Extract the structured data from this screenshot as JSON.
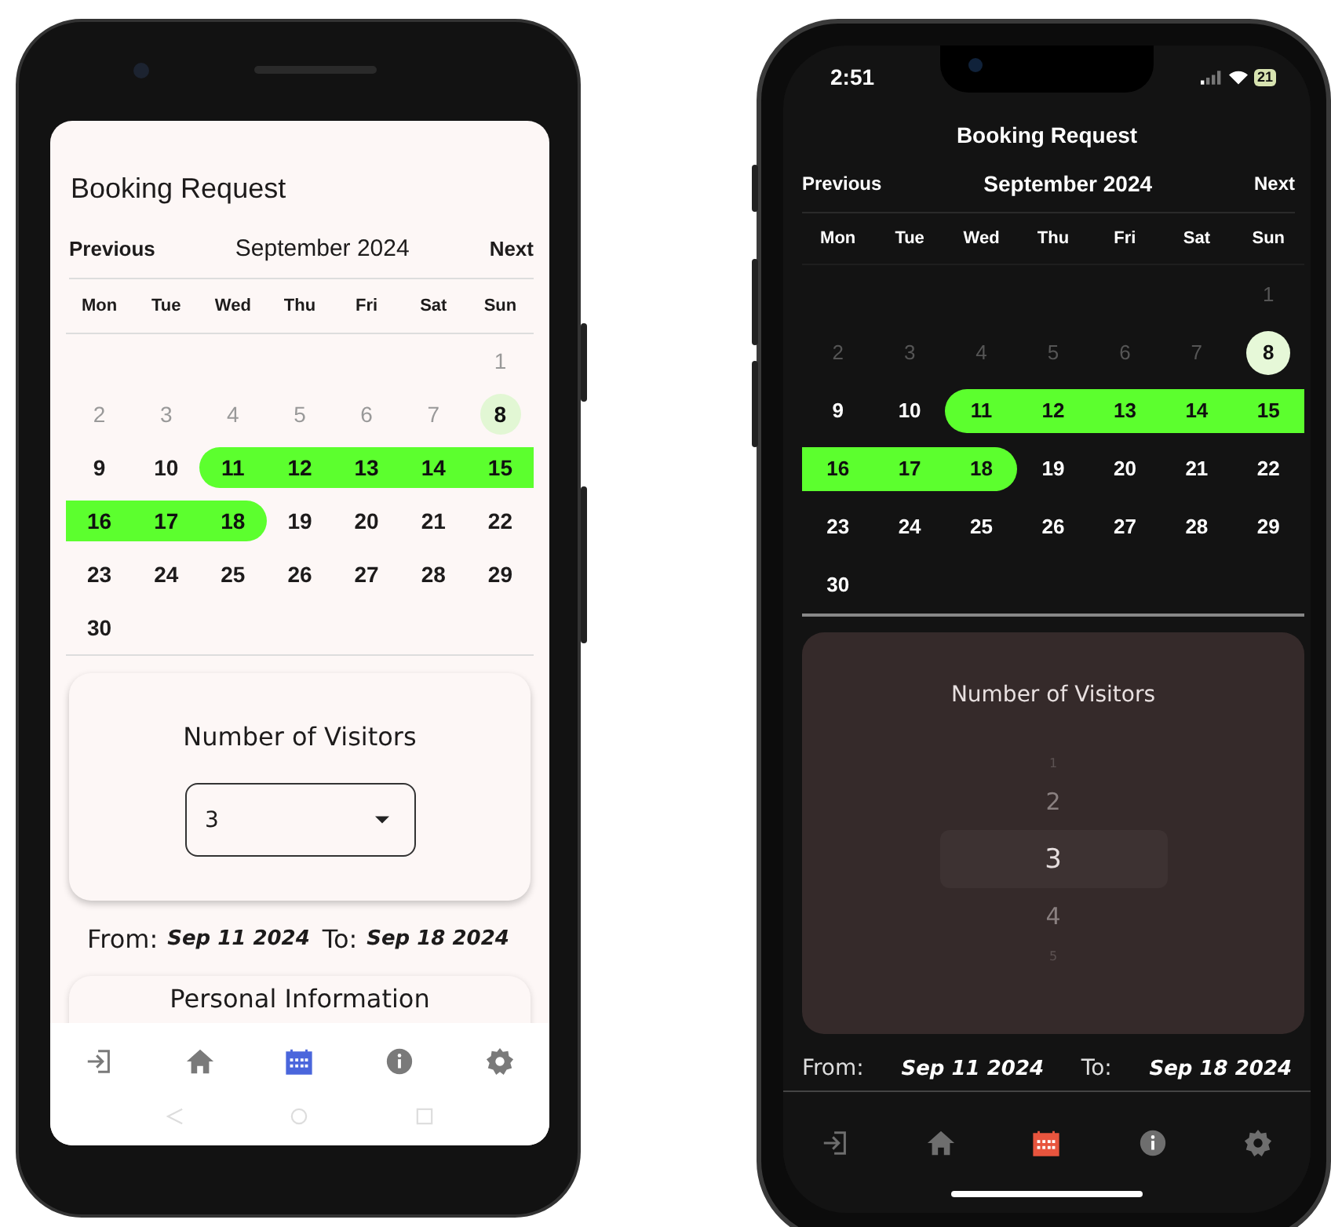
{
  "phones": [
    {
      "kind": "android",
      "title": "Booking Request",
      "calendar": {
        "previous": "Previous",
        "month": "September 2024",
        "next": "Next",
        "weekdays": [
          "Mon",
          "Tue",
          "Wed",
          "Thu",
          "Fri",
          "Sat",
          "Sun"
        ],
        "weeks": [
          [
            {
              "day": "1",
              "kind": "past",
              "selected": false
            }
          ],
          [
            {
              "day": "2",
              "kind": "past",
              "selected": false
            },
            {
              "day": "3",
              "kind": "past",
              "selected": false
            },
            {
              "day": "4",
              "kind": "past",
              "selected": false
            },
            {
              "day": "5",
              "kind": "past",
              "selected": false
            },
            {
              "day": "6",
              "kind": "past",
              "selected": false
            },
            {
              "day": "7",
              "kind": "past",
              "selected": false
            },
            {
              "day": "8",
              "kind": "today",
              "selected": false
            }
          ],
          [
            {
              "day": "9",
              "kind": "normal",
              "selected": false
            },
            {
              "day": "10",
              "kind": "normal",
              "selected": false
            },
            {
              "day": "11",
              "kind": "normal",
              "selected": true
            },
            {
              "day": "12",
              "kind": "normal",
              "selected": true
            },
            {
              "day": "13",
              "kind": "normal",
              "selected": true
            },
            {
              "day": "14",
              "kind": "normal",
              "selected": true
            },
            {
              "day": "15",
              "kind": "normal",
              "selected": true
            }
          ],
          [
            {
              "day": "16",
              "kind": "normal",
              "selected": true
            },
            {
              "day": "17",
              "kind": "normal",
              "selected": true
            },
            {
              "day": "18",
              "kind": "normal",
              "selected": true
            },
            {
              "day": "19",
              "kind": "normal",
              "selected": false
            },
            {
              "day": "20",
              "kind": "normal",
              "selected": false
            },
            {
              "day": "21",
              "kind": "normal",
              "selected": false
            },
            {
              "day": "22",
              "kind": "normal",
              "selected": false
            }
          ],
          [
            {
              "day": "23",
              "kind": "normal",
              "selected": false
            },
            {
              "day": "24",
              "kind": "normal",
              "selected": false
            },
            {
              "day": "25",
              "kind": "normal",
              "selected": false
            },
            {
              "day": "26",
              "kind": "normal",
              "selected": false
            },
            {
              "day": "27",
              "kind": "normal",
              "selected": false
            },
            {
              "day": "28",
              "kind": "normal",
              "selected": false
            },
            {
              "day": "29",
              "kind": "normal",
              "selected": false
            }
          ],
          [
            {
              "day": "30",
              "kind": "normal",
              "selected": false
            }
          ]
        ]
      },
      "visitors": {
        "label": "Number of Visitors",
        "kind": "dropdown",
        "value": "3"
      },
      "dates": {
        "from_label": "From:",
        "from": "Sep 11 2024",
        "to_label": "To:",
        "to": "Sep 18 2024"
      },
      "next_card": {
        "title": "Personal Information"
      },
      "nav": [
        {
          "kind": "login",
          "selected": false
        },
        {
          "kind": "home",
          "selected": false
        },
        {
          "kind": "calendar",
          "selected": true
        },
        {
          "kind": "info",
          "selected": false
        },
        {
          "kind": "settings",
          "selected": false
        }
      ]
    },
    {
      "kind": "ios",
      "status_bar": {
        "time": "2:51",
        "battery": "21"
      },
      "title": "Booking Request",
      "calendar": {
        "previous": "Previous",
        "month": "September 2024",
        "next": "Next",
        "weekdays": [
          "Mon",
          "Tue",
          "Wed",
          "Thu",
          "Fri",
          "Sat",
          "Sun"
        ],
        "weeks": [
          [
            {
              "day": "1",
              "kind": "past",
              "selected": false
            }
          ],
          [
            {
              "day": "2",
              "kind": "past",
              "selected": false
            },
            {
              "day": "3",
              "kind": "past",
              "selected": false
            },
            {
              "day": "4",
              "kind": "past",
              "selected": false
            },
            {
              "day": "5",
              "kind": "past",
              "selected": false
            },
            {
              "day": "6",
              "kind": "past",
              "selected": false
            },
            {
              "day": "7",
              "kind": "past",
              "selected": false
            },
            {
              "day": "8",
              "kind": "today",
              "selected": false
            }
          ],
          [
            {
              "day": "9",
              "kind": "normal",
              "selected": false
            },
            {
              "day": "10",
              "kind": "normal",
              "selected": false
            },
            {
              "day": "11",
              "kind": "normal",
              "selected": true
            },
            {
              "day": "12",
              "kind": "normal",
              "selected": true
            },
            {
              "day": "13",
              "kind": "normal",
              "selected": true
            },
            {
              "day": "14",
              "kind": "normal",
              "selected": true
            },
            {
              "day": "15",
              "kind": "normal",
              "selected": true
            }
          ],
          [
            {
              "day": "16",
              "kind": "normal",
              "selected": true
            },
            {
              "day": "17",
              "kind": "normal",
              "selected": true
            },
            {
              "day": "18",
              "kind": "normal",
              "selected": true
            },
            {
              "day": "19",
              "kind": "normal",
              "selected": false
            },
            {
              "day": "20",
              "kind": "normal",
              "selected": false
            },
            {
              "day": "21",
              "kind": "normal",
              "selected": false
            },
            {
              "day": "22",
              "kind": "normal",
              "selected": false
            }
          ],
          [
            {
              "day": "23",
              "kind": "normal",
              "selected": false
            },
            {
              "day": "24",
              "kind": "normal",
              "selected": false
            },
            {
              "day": "25",
              "kind": "normal",
              "selected": false
            },
            {
              "day": "26",
              "kind": "normal",
              "selected": false
            },
            {
              "day": "27",
              "kind": "normal",
              "selected": false
            },
            {
              "day": "28",
              "kind": "normal",
              "selected": false
            },
            {
              "day": "29",
              "kind": "normal",
              "selected": false
            }
          ],
          [
            {
              "day": "30",
              "kind": "normal",
              "selected": false
            }
          ]
        ]
      },
      "visitors": {
        "label": "Number of Visitors",
        "kind": "wheel",
        "options": [
          {
            "label": "1",
            "selected": false
          },
          {
            "label": "2",
            "selected": false
          },
          {
            "label": "3",
            "selected": true
          },
          {
            "label": "4",
            "selected": false
          },
          {
            "label": "5",
            "selected": false
          }
        ]
      },
      "dates": {
        "from_label": "From:",
        "from": "Sep 11 2024",
        "to_label": "To:",
        "to": "Sep 18 2024"
      },
      "nav": [
        {
          "kind": "login",
          "selected": false
        },
        {
          "kind": "home",
          "selected": false
        },
        {
          "kind": "calendar",
          "selected": true
        },
        {
          "kind": "info",
          "selected": false
        },
        {
          "kind": "settings",
          "selected": false
        }
      ]
    }
  ]
}
